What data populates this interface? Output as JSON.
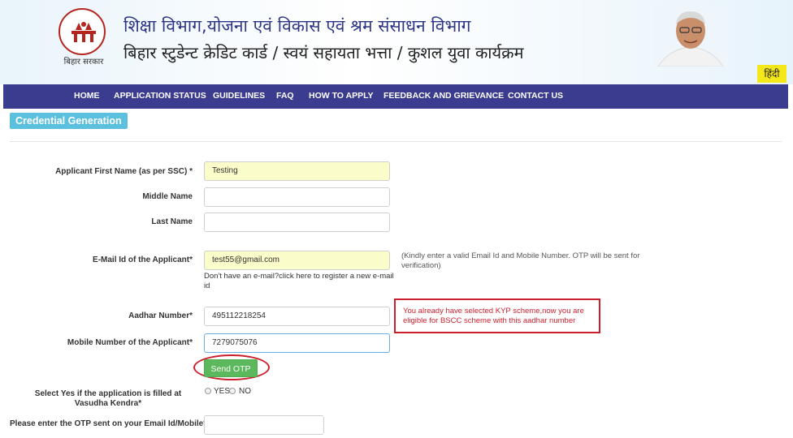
{
  "header": {
    "emblem_caption": "बिहार सरकार",
    "department_title": "शिक्षा विभाग,योजना एवं विकास एवं श्रम संसाधन विभाग",
    "scheme_title": "बिहार स्टुडेन्ट क्रेडिट कार्ड / स्वयं सहायता भत्ता / कुशल युवा कार्यक्रम",
    "language_button": "हिंदी"
  },
  "nav": {
    "items": [
      {
        "label": "HOME"
      },
      {
        "label": "APPLICATION STATUS"
      },
      {
        "label": "GUIDELINES"
      },
      {
        "label": "FAQ"
      },
      {
        "label": "HOW TO APPLY"
      },
      {
        "label": "FEEDBACK AND GRIEVANCE"
      },
      {
        "label": "CONTACT US"
      }
    ]
  },
  "section": {
    "title": "Credential Generation"
  },
  "form": {
    "first_name": {
      "label": "Applicant First Name (as per SSC) *",
      "value": "Testing"
    },
    "middle_name": {
      "label": "Middle Name",
      "value": ""
    },
    "last_name": {
      "label": "Last Name",
      "value": ""
    },
    "email": {
      "label": "E-Mail Id of the Applicant*",
      "value": "test55@gmail.com",
      "register_link": "Don't have an e-mail?click here to register a new e-mail id",
      "hint": "(Kindly enter a valid Email Id and Mobile Number. OTP will be sent for verification)"
    },
    "aadhar": {
      "label": "Aadhar Number*",
      "value": "495112218254",
      "alert": "You already have selected KYP scheme,now you are eligible for BSCC scheme with this aadhar number"
    },
    "mobile": {
      "label": "Mobile Number of the Applicant*",
      "value": "7279075076"
    },
    "send_otp_label": "Send OTP",
    "vasudha": {
      "label": "Select Yes if the application is filled at Vasudha Kendra*",
      "yes_label": "YES",
      "no_label": "NO",
      "selected": "none"
    },
    "otp": {
      "label": "Please enter the OTP sent on your Email Id/Mobile*",
      "value": ""
    }
  },
  "colors": {
    "nav_bg": "#3b3b8f",
    "section_tag": "#5bc0de",
    "filled_field": "#fafcc9",
    "alert": "#cc1f2d",
    "otp_button": "#5cb85c"
  }
}
